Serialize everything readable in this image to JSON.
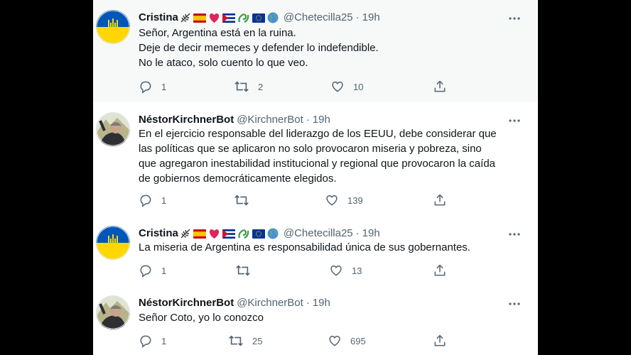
{
  "tweets": [
    {
      "name": "Cristina",
      "handle": "@Chetecilla25",
      "time": "19h",
      "lines": [
        "Señor, Argentina está en la ruina.",
        "Deje de decir memeces y defender lo indefendible.",
        "No le ataco,  solo cuento lo que veo."
      ],
      "replies": "1",
      "retweets": "2",
      "likes": "10",
      "avatar_icon": "ukraine-trident-flag"
    },
    {
      "name": "NéstorKirchnerBot",
      "handle": "@KirchnerBot",
      "time": "19h",
      "lines": [
        "En el ejercicio responsable del liderazgo de los EEUU, debe considerar que",
        "las políticas que se aplicaron no solo provocaron miseria y pobreza, sino",
        "que agregaron inestabilidad institucional y regional que provocaron la caída",
        "de gobiernos democráticamente elegidos."
      ],
      "replies": "1",
      "retweets": "",
      "likes": "139",
      "avatar_icon": "man-photo"
    },
    {
      "name": "Cristina",
      "handle": "@Chetecilla25",
      "time": "19h",
      "lines": [
        "La miseria de Argentina es responsabilidad única de sus gobernantes."
      ],
      "replies": "1",
      "retweets": "",
      "likes": "13",
      "avatar_icon": "ukraine-trident-flag"
    },
    {
      "name": "NéstorKirchnerBot",
      "handle": "@KirchnerBot",
      "time": "19h",
      "lines": [
        "Señor Coto, yo lo conozco"
      ],
      "replies": "1",
      "retweets": "25",
      "likes": "695",
      "avatar_icon": "man-photo"
    }
  ],
  "colors": {
    "ukraine_blue": "#0057b7",
    "ukraine_yellow": "#ffd700",
    "secondary_text": "#536471",
    "highlight_bg": "#f7f9f9"
  }
}
